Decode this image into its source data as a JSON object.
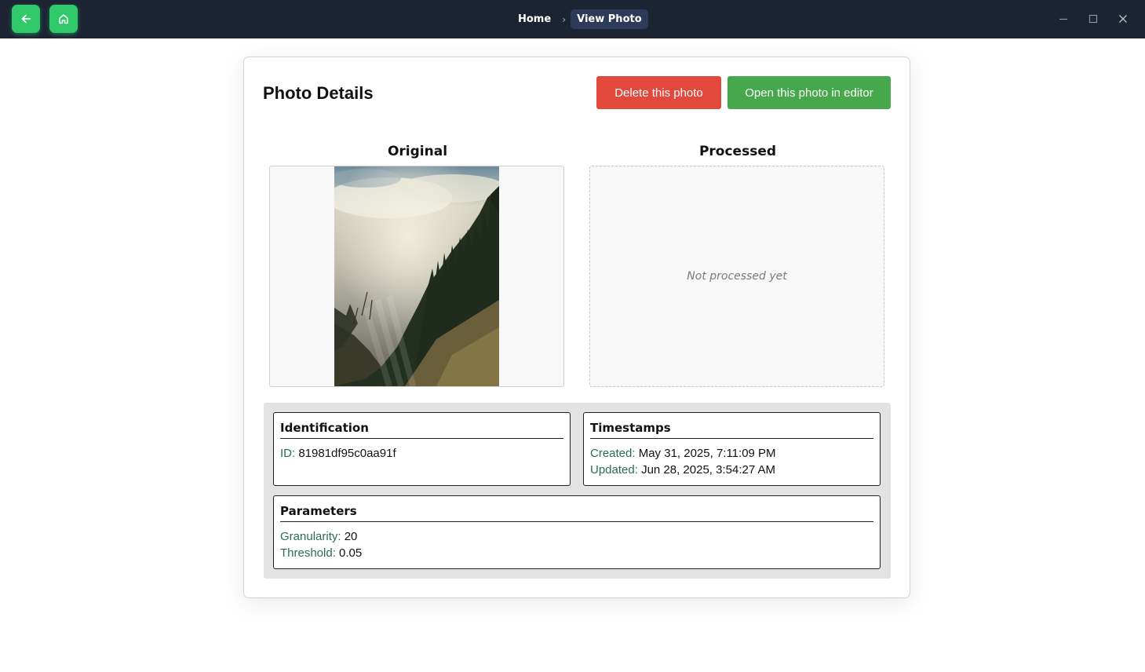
{
  "breadcrumb": {
    "home": "Home",
    "separator": "›",
    "current": "View Photo"
  },
  "titlebar": {
    "back_icon": "arrow-left-icon",
    "home_icon": "home-icon",
    "accent": "#2fc96a",
    "background": "#1c2434"
  },
  "window_controls": [
    "minimize-icon",
    "maximize-icon",
    "close-icon"
  ],
  "page": {
    "title": "Photo Details",
    "delete_label": "Delete this photo",
    "editor_label": "Open this photo in editor",
    "delete_color": "#e3483d",
    "editor_color": "#46a84a"
  },
  "panes": {
    "original_title": "Original",
    "processed_title": "Processed",
    "processed_placeholder": "Not processed yet"
  },
  "identification": {
    "title": "Identification",
    "id_label": "ID:",
    "id_value": "81981df95c0aa91f"
  },
  "timestamps": {
    "title": "Timestamps",
    "created_label": "Created:",
    "created_value": "May 31, 2025, 7:11:09 PM",
    "updated_label": "Updated:",
    "updated_value": "Jun 28, 2025, 3:54:27 AM"
  },
  "parameters": {
    "title": "Parameters",
    "granularity_label": "Granularity:",
    "granularity_value": "20",
    "threshold_label": "Threshold:",
    "threshold_value": "0.05"
  }
}
